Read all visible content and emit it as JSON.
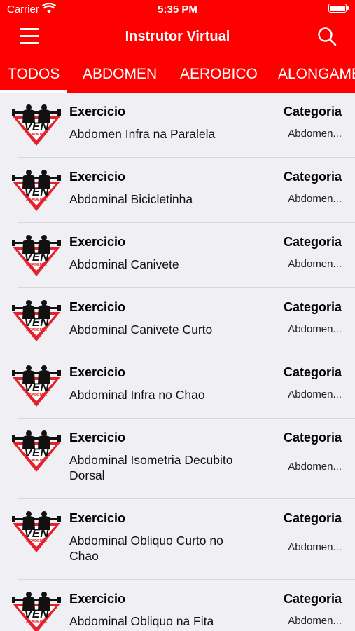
{
  "status": {
    "carrier": "Carrier",
    "time": "5:35 PM"
  },
  "nav": {
    "title": "Instrutor Virtual"
  },
  "tabs": [
    {
      "label": "TODOS"
    },
    {
      "label": "ABDOMEN"
    },
    {
      "label": "AEROBICO"
    },
    {
      "label": "ALONGAMENTO"
    }
  ],
  "logo": {
    "text": "VEN",
    "subtext": "ACADEMIA"
  },
  "list": {
    "exercise_header": "Exercicio",
    "category_header": "Categoria",
    "items": [
      {
        "name": "Abdomen Infra na Paralela",
        "category": "Abdomen..."
      },
      {
        "name": "Abdominal Bicicletinha",
        "category": "Abdomen..."
      },
      {
        "name": "Abdominal Canivete",
        "category": "Abdomen..."
      },
      {
        "name": "Abdominal Canivete Curto",
        "category": "Abdomen..."
      },
      {
        "name": "Abdominal Infra no Chao",
        "category": "Abdomen..."
      },
      {
        "name": "Abdominal Isometria Decubito Dorsal",
        "category": "Abdomen..."
      },
      {
        "name": "Abdominal Obliquo Curto no Chao",
        "category": "Abdomen..."
      },
      {
        "name": "Abdominal Obliquo na Fita",
        "category": "Abdomen..."
      }
    ]
  },
  "colors": {
    "primary": "#ff0000",
    "background": "#efeff4",
    "logo_red": "#e3232c"
  }
}
